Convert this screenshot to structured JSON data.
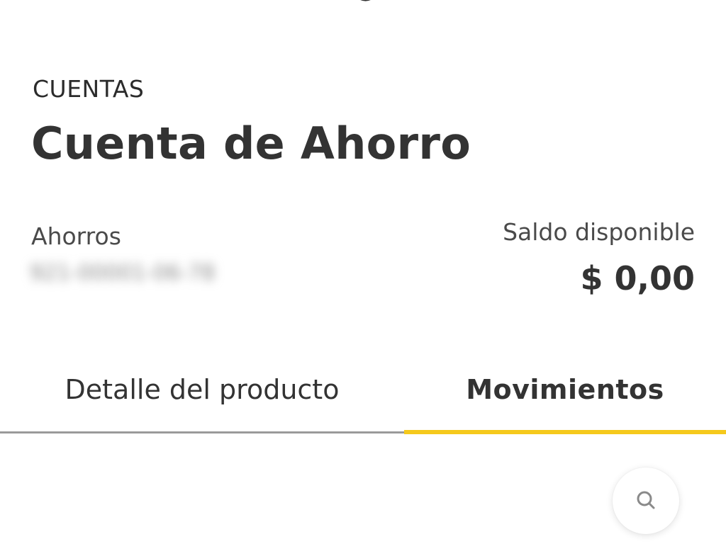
{
  "header": {
    "section_label": "CUENTAS",
    "title": "Cuenta de Ahorro"
  },
  "account": {
    "type": "Ahorros",
    "number": "921-00001-06-78"
  },
  "balance": {
    "label": "Saldo disponible",
    "value": "$ 0,00"
  },
  "tabs": [
    {
      "label": "Detalle del producto",
      "active": false
    },
    {
      "label": "Movimientos",
      "active": true
    }
  ],
  "colors": {
    "accent": "#f5c91c",
    "text": "#333333",
    "inactive_line": "#9a9a9a"
  },
  "icons": {
    "search": "search-icon"
  }
}
